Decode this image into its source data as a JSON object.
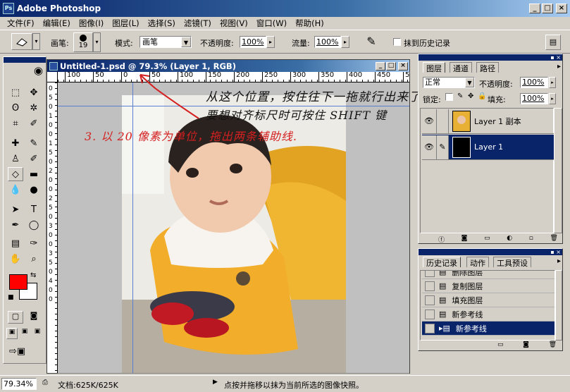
{
  "app": {
    "title": "Adobe Photoshop",
    "icon": "photoshop-icon"
  },
  "window_buttons": [
    "_",
    "□",
    "×"
  ],
  "menu": [
    "文件(F)",
    "编辑(E)",
    "图像(I)",
    "图层(L)",
    "选择(S)",
    "滤镜(T)",
    "视图(V)",
    "窗口(W)",
    "帮助(H)"
  ],
  "options": {
    "brush_label": "画笔:",
    "brush_size": "19",
    "mode_label": "模式:",
    "mode_value": "画笔",
    "opacity_label": "不透明度:",
    "opacity_value": "100%",
    "flow_label": "流量:",
    "flow_value": "100%",
    "history_label": "抹到历史记录"
  },
  "document": {
    "title": "Untitled-1.psd @ 79.3% (Layer 1, RGB)",
    "ruler_h": [
      "100",
      "50",
      "0",
      "50",
      "100",
      "150",
      "200",
      "250",
      "300",
      "350",
      "400",
      "450",
      "5"
    ],
    "ruler_v": [
      "0",
      "5",
      "0",
      "1",
      "0",
      "0",
      "1",
      "5",
      "0",
      "2",
      "0",
      "0",
      "2",
      "5",
      "0",
      "3",
      "0",
      "0",
      "3",
      "5",
      "0",
      "4",
      "0",
      "0"
    ]
  },
  "annotations": {
    "top": "从这个位置，按住往下一拖就行出来了",
    "top2": "要想对齐标尺时可按住 SHIFT 键",
    "left": "3. 以 20 像素为单位，拖出两条辅助线."
  },
  "layers_panel": {
    "tabs": [
      "图层",
      "通道",
      "路径"
    ],
    "blend_mode": "正常",
    "opacity_label": "不透明度:",
    "opacity_value": "100%",
    "lock_label": "锁定:",
    "fill_label": "填充:",
    "fill_value": "100%",
    "layers": [
      {
        "name": "Layer 1 副本",
        "selected": false
      },
      {
        "name": "Layer 1",
        "selected": true
      }
    ]
  },
  "history_panel": {
    "tabs": [
      "历史记录",
      "动作",
      "工具预设"
    ],
    "items": [
      {
        "label": "删除图层",
        "selected": false
      },
      {
        "label": "复制图层",
        "selected": false
      },
      {
        "label": "填充图层",
        "selected": false
      },
      {
        "label": "新参考线",
        "selected": false
      },
      {
        "label": "新参考线",
        "selected": true
      }
    ]
  },
  "status": {
    "zoom": "79.34%",
    "doc": "文档:625K/625K",
    "hint": "点按并拖移以抹为当前所选的图像快照。"
  },
  "colors": {
    "foreground": "#ff0000",
    "background": "#ffffff",
    "selection": "#0a246a",
    "annotation": "#d42020"
  }
}
